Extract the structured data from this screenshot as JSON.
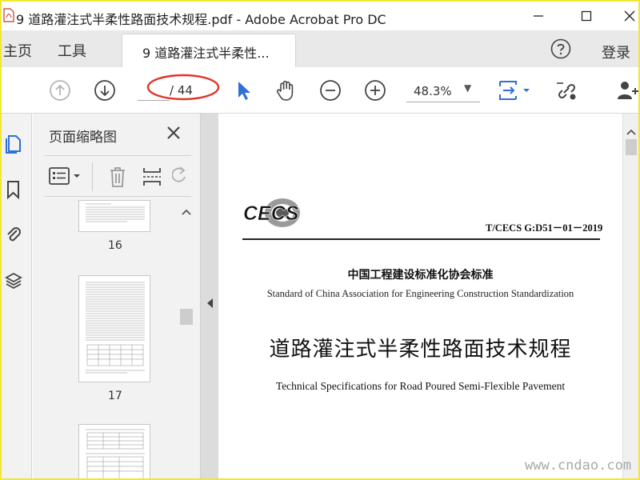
{
  "window": {
    "title": "9 道路灌注式半柔性路面技术规程.pdf - Adobe Acrobat Pro DC"
  },
  "tabs": {
    "home": "主页",
    "tools": "工具",
    "document": "9 道路灌注式半柔性...",
    "login": "登录"
  },
  "toolbar": {
    "page_current": "",
    "page_total": "/ 44",
    "zoom": "48.3%"
  },
  "sidebar": {
    "title": "页面缩略图",
    "thumbnails": [
      {
        "label": "16"
      },
      {
        "label": "17"
      }
    ]
  },
  "page": {
    "logo_text": "CECS",
    "standard_code": "T/CECS G:D51－01－2019",
    "org_cn": "中国工程建设标准化协会标准",
    "org_en": "Standard of China Association for Engineering Construction Standardization",
    "title_cn": "道路灌注式半柔性路面技术规程",
    "title_en": "Technical Specifications for Road Poured Semi-Flexible Pavement"
  },
  "watermark": "www.cndao.com",
  "colors": {
    "frame": "#f1e832",
    "accent_blue": "#2f6fd6",
    "annotation_red": "#e0352b"
  }
}
